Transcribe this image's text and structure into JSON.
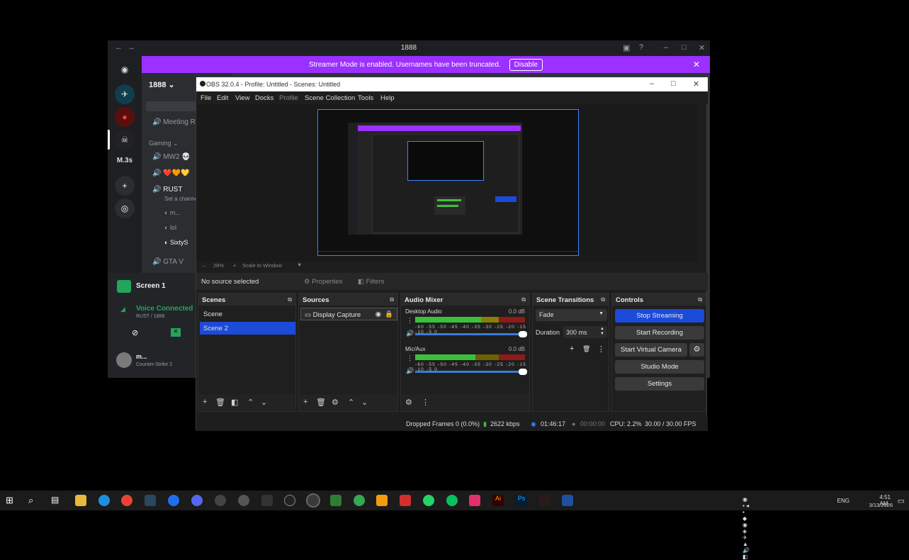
{
  "discord": {
    "title": "1888",
    "banner_text": "Streamer Mode is enabled. Usernames have been truncated.",
    "banner_button": "Disable",
    "server_name": "1888",
    "rail_label": "M.3s",
    "channels": {
      "meeting": "Meeting R",
      "category_gaming": "Gaming",
      "mw2": "MW2 💀",
      "hearts": "❤️🧡💛",
      "rust": "RUST",
      "rust_topic": "Set a channel",
      "user_m": "m...",
      "user_lol": "lol",
      "user_sixty": "SixtyS",
      "gta": "GTA V"
    },
    "screen_share": "Screen 1",
    "voice_status": "Voice Connected",
    "voice_sub": "RUST / 1888",
    "user_name": "m...",
    "user_activity": "Counter-Strike 2"
  },
  "obs": {
    "title": "OBS 32.0.4 - Profile: Untitled - Scenes: Untitled",
    "menu": [
      "File",
      "Edit",
      "View",
      "Docks",
      "Profile",
      "Scene Collection",
      "Tools",
      "Help"
    ],
    "zoom": "28%",
    "scale_mode": "Scale to Window",
    "no_source": "No source selected",
    "properties": "Properties",
    "filters": "Filters",
    "scenes_title": "Scenes",
    "scenes": [
      "Scene",
      "Scene 2"
    ],
    "sources_title": "Sources",
    "sources": [
      "Display Capture"
    ],
    "mixer_title": "Audio Mixer",
    "mixer": [
      {
        "name": "Desktop Audio",
        "db": "0.0 dB",
        "level": 0.82
      },
      {
        "name": "Mic/Aux",
        "db": "0.0 dB",
        "level": 0.55
      }
    ],
    "meter_scale": "-60 -55 -50 -45 -40 -35 -30 -25 -20 -15 -10 -5 0",
    "transitions_title": "Scene Transitions",
    "transition": "Fade",
    "duration_label": "Duration",
    "duration_value": "300 ms",
    "controls_title": "Controls",
    "controls": {
      "stop_streaming": "Stop Streaming",
      "start_recording": "Start Recording",
      "start_virtual_camera": "Start Virtual Camera",
      "studio_mode": "Studio Mode",
      "settings": "Settings"
    },
    "status": {
      "dropped": "Dropped Frames 0 (0.0%)",
      "bitrate": "2622 kbps",
      "stream_time": "01:46:17",
      "rec_time": "00:00:00",
      "cpu": "CPU: 2.2%",
      "fps": "30.00 / 30.00 FPS"
    }
  },
  "taskbar": {
    "lang": "ENG",
    "time": "4:51 AM",
    "date": "3/13/2026"
  },
  "colors": {
    "accent": "#1c4ad9",
    "banner": "#9b30ff",
    "obs_bg": "#1e1e1e"
  }
}
